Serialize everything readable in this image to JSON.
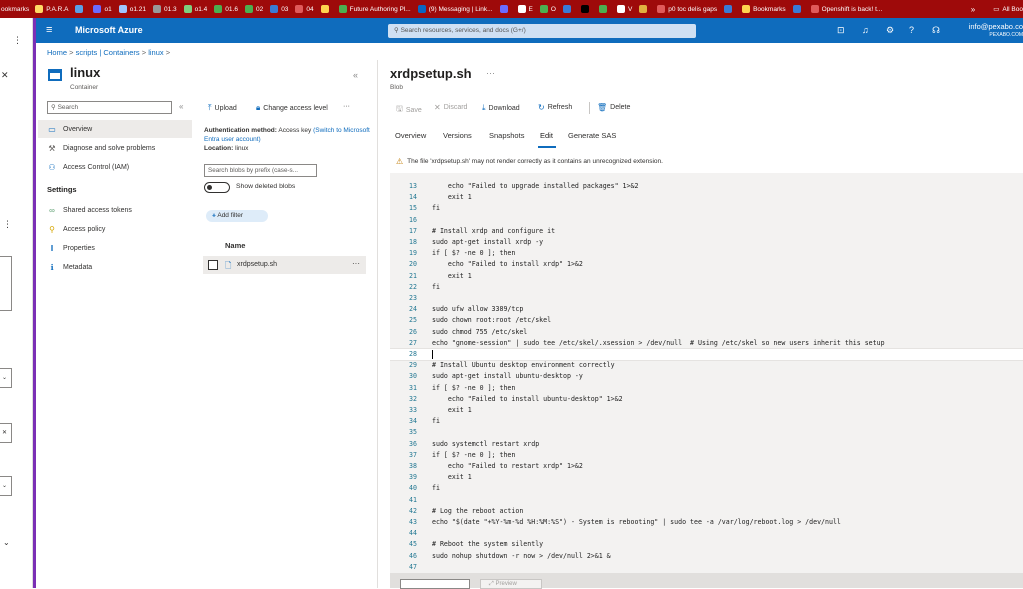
{
  "browser": {
    "bookmarks": [
      {
        "label": "P.A.R.A",
        "color": "#ffd966"
      },
      {
        "label": "",
        "color": "#5aa0e6"
      },
      {
        "label": "o1",
        "color": "#6b6bff"
      },
      {
        "label": "o1.21",
        "color": "#a0c4ff"
      },
      {
        "label": "01.3",
        "color": "#999999"
      },
      {
        "label": "o1.4",
        "color": "#7fd07f"
      },
      {
        "label": "01.6",
        "color": "#4caf50"
      },
      {
        "label": "02",
        "color": "#4caf50"
      },
      {
        "label": "03",
        "color": "#3a7bd5"
      },
      {
        "label": "04",
        "color": "#e05a5a"
      },
      {
        "label": "",
        "color": "#ffd54f"
      },
      {
        "label": "Future Authoring Pl...",
        "color": "#4caf50"
      },
      {
        "label": "(9) Messaging | Link...",
        "color": "#0a66c2"
      },
      {
        "label": "",
        "color": "#6b6bff"
      },
      {
        "label": "E",
        "color": "#ffffff"
      },
      {
        "label": "O",
        "color": "#4caf50"
      },
      {
        "label": "",
        "color": "#3a7bd5"
      },
      {
        "label": "",
        "color": "#000000"
      },
      {
        "label": "",
        "color": "#4caf50"
      },
      {
        "label": "V",
        "color": "#ffffff"
      },
      {
        "label": "",
        "color": "#e0b040"
      },
      {
        "label": "p0 toc delis gaps",
        "color": "#e05a5a"
      },
      {
        "label": "",
        "color": "#3a7bd5"
      },
      {
        "label": "Bookmarks",
        "color": "#ffd54f"
      },
      {
        "label": "",
        "color": "#3a7bd5"
      },
      {
        "label": "Openshift is back! t...",
        "color": "#e05a5a"
      }
    ],
    "left_label": "ookmarks",
    "more": "»",
    "all_bookmarks": "All Boo"
  },
  "azure": {
    "brand": "Microsoft Azure",
    "search_placeholder": "Search resources, services, and docs (G+/)",
    "account_email": "info@pexabo.co",
    "account_org": "PEXABO.COM"
  },
  "breadcrumb": [
    "Home",
    "scripts | Containers",
    "linux"
  ],
  "left": {
    "title": "linux",
    "subtitle": "Container",
    "search_placeholder": "Search",
    "nav": [
      {
        "label": "Overview",
        "icon": "overview-icon",
        "glyph": "▭"
      },
      {
        "label": "Diagnose and solve problems",
        "icon": "wrench-icon",
        "glyph": "⚒"
      },
      {
        "label": "Access Control (IAM)",
        "icon": "people-icon",
        "glyph": "⚇"
      }
    ],
    "settings_header": "Settings",
    "settings": [
      {
        "label": "Shared access tokens",
        "icon": "link-icon",
        "glyph": "∞"
      },
      {
        "label": "Access policy",
        "icon": "key-icon",
        "glyph": "⚲"
      },
      {
        "label": "Properties",
        "icon": "properties-icon",
        "glyph": "‖"
      },
      {
        "label": "Metadata",
        "icon": "info-icon",
        "glyph": "ℹ"
      }
    ]
  },
  "middle": {
    "upload": "Upload",
    "change_access": "Change access level",
    "auth_label": "Authentication method:",
    "auth_value": "Access key",
    "auth_link": "(Switch to Microsoft Entra user account)",
    "location_label": "Location:",
    "location_value": "linux",
    "search_placeholder": "Search blobs by prefix (case-s...",
    "show_deleted": "Show deleted blobs",
    "add_filter": "Add filter",
    "col_name": "Name",
    "file": "xrdpsetup.sh"
  },
  "right": {
    "title": "xrdpsetup.sh",
    "subtitle": "Blob",
    "toolbar": {
      "save": "Save",
      "discard": "Discard",
      "download": "Download",
      "refresh": "Refresh",
      "delete": "Delete"
    },
    "tabs": [
      "Overview",
      "Versions",
      "Snapshots",
      "Edit",
      "Generate SAS"
    ],
    "selected_tab": "Edit",
    "warning": "The file 'xrdpsetup.sh' may not render correctly as it contains an unrecognized extension.",
    "preview_btn": "Preview"
  },
  "editor": {
    "current_line": 28,
    "lines": [
      {
        "n": "13",
        "t": "    echo \"Failed to upgrade installed packages\" 1>&2"
      },
      {
        "n": "14",
        "t": "    exit 1"
      },
      {
        "n": "15",
        "t": "fi"
      },
      {
        "n": "16",
        "t": ""
      },
      {
        "n": "17",
        "t": "# Install xrdp and configure it"
      },
      {
        "n": "18",
        "t": "sudo apt-get install xrdp -y"
      },
      {
        "n": "19",
        "t": "if [ $? -ne 0 ]; then"
      },
      {
        "n": "20",
        "t": "    echo \"Failed to install xrdp\" 1>&2"
      },
      {
        "n": "21",
        "t": "    exit 1"
      },
      {
        "n": "22",
        "t": "fi"
      },
      {
        "n": "23",
        "t": ""
      },
      {
        "n": "24",
        "t": "sudo ufw allow 3389/tcp"
      },
      {
        "n": "25",
        "t": "sudo chown root:root /etc/skel"
      },
      {
        "n": "26",
        "t": "sudo chmod 755 /etc/skel"
      },
      {
        "n": "27",
        "t": "echo \"gnome-session\" | sudo tee /etc/skel/.xsession > /dev/null  # Using /etc/skel so new users inherit this setup"
      },
      {
        "n": "28",
        "t": ""
      },
      {
        "n": "29",
        "t": "# Install Ubuntu desktop environment correctly"
      },
      {
        "n": "30",
        "t": "sudo apt-get install ubuntu-desktop -y"
      },
      {
        "n": "31",
        "t": "if [ $? -ne 0 ]; then"
      },
      {
        "n": "32",
        "t": "    echo \"Failed to install ubuntu-desktop\" 1>&2"
      },
      {
        "n": "33",
        "t": "    exit 1"
      },
      {
        "n": "34",
        "t": "fi"
      },
      {
        "n": "35",
        "t": ""
      },
      {
        "n": "36",
        "t": "sudo systemctl restart xrdp"
      },
      {
        "n": "37",
        "t": "if [ $? -ne 0 ]; then"
      },
      {
        "n": "38",
        "t": "    echo \"Failed to restart xrdp\" 1>&2"
      },
      {
        "n": "39",
        "t": "    exit 1"
      },
      {
        "n": "40",
        "t": "fi"
      },
      {
        "n": "41",
        "t": ""
      },
      {
        "n": "42",
        "t": "# Log the reboot action"
      },
      {
        "n": "43",
        "t": "echo \"$(date \"+%Y-%m-%d %H:%M:%S\") - System is rebooting\" | sudo tee -a /var/log/reboot.log > /dev/null"
      },
      {
        "n": "44",
        "t": ""
      },
      {
        "n": "45",
        "t": "# Reboot the system silently"
      },
      {
        "n": "46",
        "t": "sudo nohup shutdown -r now > /dev/null 2>&1 &"
      },
      {
        "n": "47",
        "t": ""
      }
    ]
  }
}
